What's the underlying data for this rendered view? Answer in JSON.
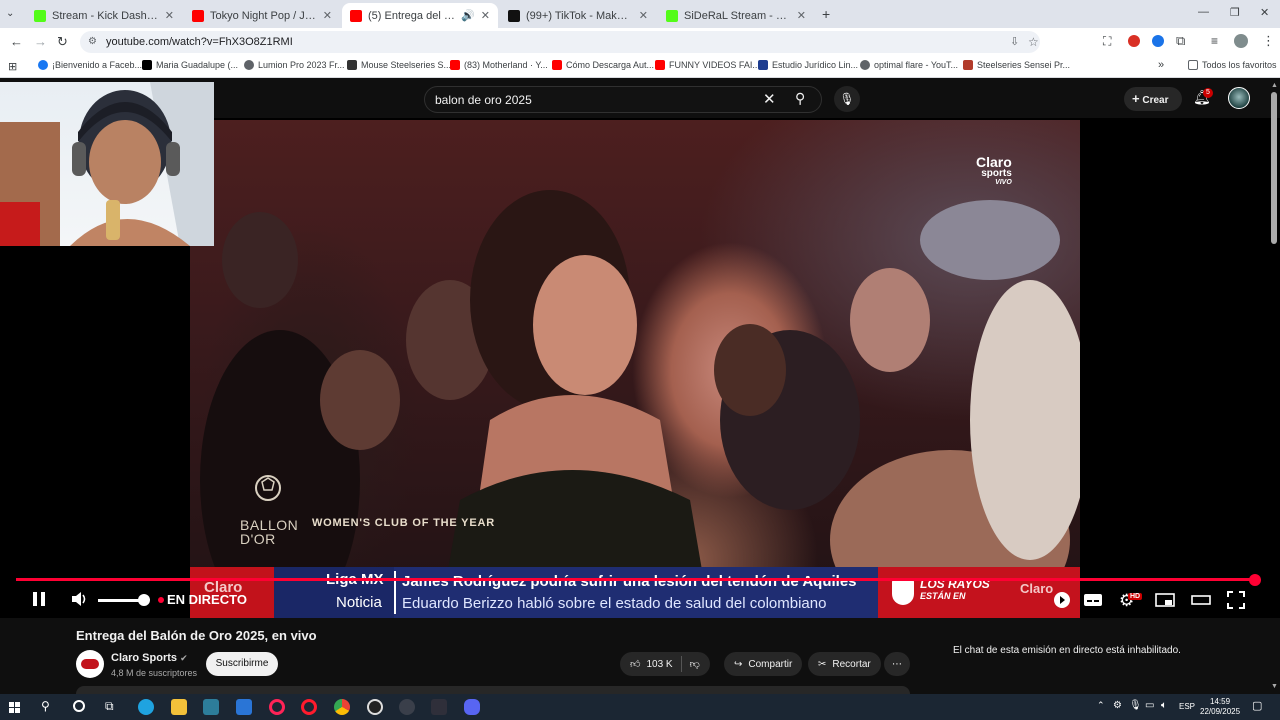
{
  "browser": {
    "tabs": [
      {
        "title": "Stream - Kick Dashboard",
        "color": "#53fc18"
      },
      {
        "title": "Tokyo Night Pop / Japanese Ne",
        "color": "#ff0000"
      },
      {
        "title": "(5) Entrega del Balón de Or",
        "color": "#ff0000",
        "active": true
      },
      {
        "title": "(99+) TikTok - Make Your Day",
        "color": "#111111"
      },
      {
        "title": "SiDeRaL Stream - Watch Live o",
        "color": "#53fc18"
      }
    ],
    "url": "youtube.com/watch?v=FhX3O8Z1RMI",
    "bookmarks": [
      "¡Bienvenido a Faceb...",
      "Maria Guadalupe (...",
      "Lumion Pro 2023 Fr...",
      "Mouse Steelseries S...",
      "(83) Motherland · Y...",
      "Cómo Descarga Aut...",
      "FUNNY VIDEOS FAI...",
      "Estudio Jurídico Lin...",
      "optimal flare - YouT...",
      "Steelseries Sensei Pr..."
    ],
    "all_bookmarks": "Todos los favoritos"
  },
  "youtube": {
    "search_query": "balon de oro 2025",
    "create_label": "Crear",
    "notification_count": "5",
    "live_label": "EN DIRECTO",
    "video": {
      "ballon_line1": "BALLON",
      "ballon_line2": "D'OR",
      "caption": "WOMEN'S CLUB OF THE YEAR",
      "watermark_line1": "Claro",
      "watermark_line2": "sports",
      "watermark_line3": "VIVO"
    },
    "ticker": {
      "left_logo": "Claro",
      "liga_title": "Liga MX",
      "liga_sub": "Noticia",
      "headline": "James Rodríguez podría sufrir una lesión del tendón de Aquiles",
      "subline": "Eduardo Berizzo habló sobre el estado de salud del colombiano",
      "right_promo_line1": "LOS RAYOS",
      "right_promo_line2": "ESTÁN EN",
      "right_logo": "Claro"
    },
    "quality_badge": "HD",
    "title": "Entrega del Balón de Oro 2025, en vivo",
    "channel": "Claro Sports",
    "subscribers": "4,8 M de suscriptores",
    "subscribe_label": "Suscribirme",
    "likes": "103 K",
    "share_label": "Compartir",
    "clip_label": "Recortar",
    "chat_message": "El chat de esta emisión en directo está inhabilitado."
  },
  "taskbar": {
    "language": "ESP",
    "time": "14:59",
    "date": "22/09/2025"
  }
}
